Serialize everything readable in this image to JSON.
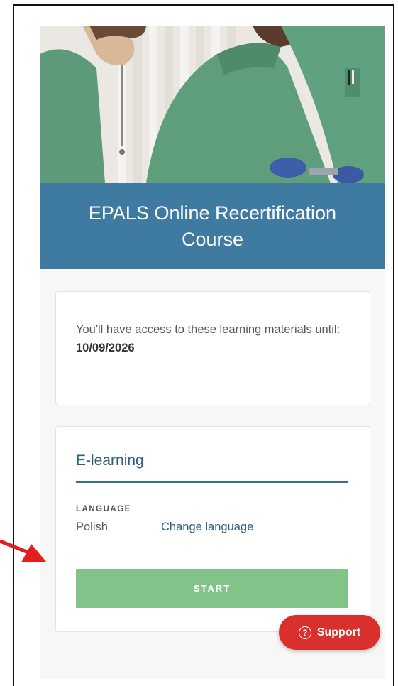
{
  "course": {
    "title": "EPALS Online Recertification Course",
    "hero_image": "medical-training-photo"
  },
  "access": {
    "prefix": "You'll have access to these learning materials until: ",
    "date": "10/09/2026"
  },
  "elearning": {
    "heading": "E-learning",
    "language_label": "LANGUAGE",
    "language_value": "Polish",
    "change_language_label": "Change language",
    "start_label": "START"
  },
  "support": {
    "icon": "question-circle-icon",
    "label": "Support"
  },
  "annotation": {
    "icon": "red-arrow-icon"
  },
  "colors": {
    "title_band": "#3f7ba0",
    "start_button": "#82c38a",
    "support_button": "#d9302d",
    "link": "#2f5f7f",
    "arrow": "#e21e1e"
  }
}
